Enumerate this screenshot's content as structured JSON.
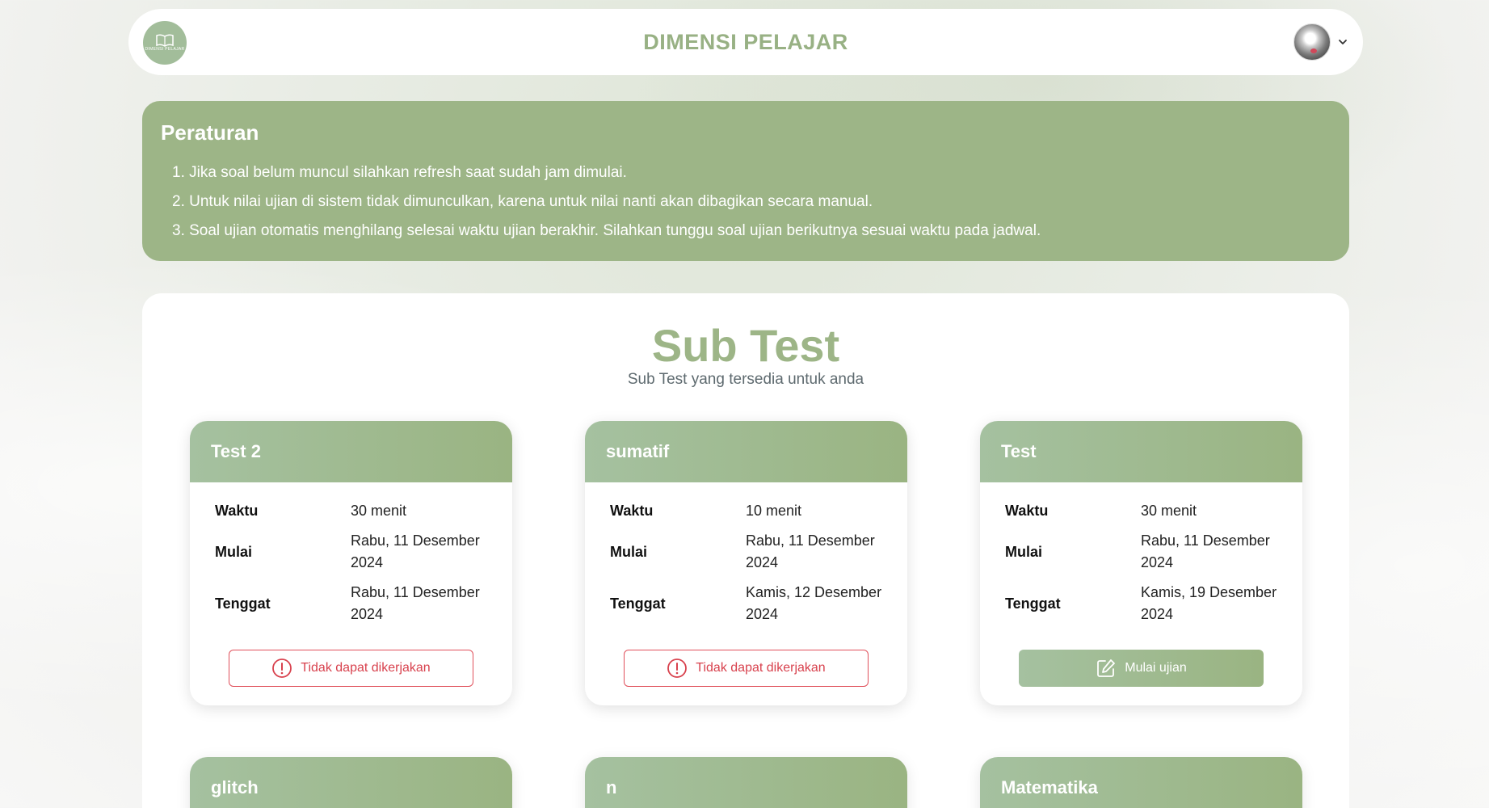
{
  "app": {
    "title": "DIMENSI PELAJAR",
    "logo_text": "DIMENSI PELAJAR"
  },
  "colors": {
    "accent": "#9db587",
    "danger": "#d8414d"
  },
  "rules": {
    "title": "Peraturan",
    "items": [
      "1. Jika soal belum muncul silahkan refresh saat sudah jam dimulai.",
      "2. Untuk nilai ujian di sistem tidak dimunculkan, karena untuk nilai nanti akan dibagikan secara manual.",
      "3. Soal ujian otomatis menghilang selesai waktu ujian berakhir. Silahkan tunggu soal ujian berikutnya sesuai waktu pada jadwal."
    ]
  },
  "subtest": {
    "title": "Sub Test",
    "subtitle": "Sub Test yang tersedia untuk anda",
    "labels": {
      "time": "Waktu",
      "start": "Mulai",
      "due": "Tenggat"
    },
    "cards": [
      {
        "name": "Test 2",
        "time": "30 menit",
        "start": "Rabu, 11 Desember 2024",
        "due": "Rabu, 11 Desember 2024",
        "action": "Tidak dapat dikerjakan",
        "action_icon": "alert-circle-icon"
      },
      {
        "name": "sumatif",
        "time": "10 menit",
        "start": "Rabu, 11 Desember 2024",
        "due": "Kamis, 12 Desember 2024",
        "action": "Tidak dapat dikerjakan",
        "action_icon": "alert-circle-icon"
      },
      {
        "name": "Test",
        "time": "30 menit",
        "start": "Rabu, 11 Desember 2024",
        "due": "Kamis, 19 Desember 2024",
        "action": "Mulai ujian",
        "action_icon": "edit-icon"
      },
      {
        "name": "glitch"
      },
      {
        "name": "n"
      },
      {
        "name": "Matematika"
      }
    ]
  }
}
